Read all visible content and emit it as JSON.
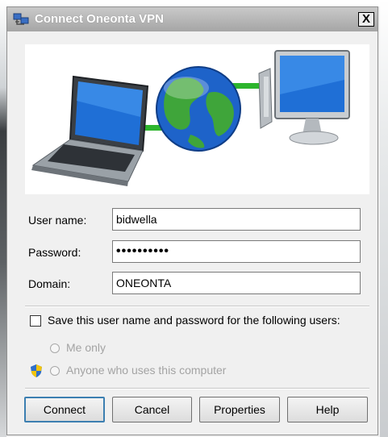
{
  "window": {
    "title": "Connect Oneonta VPN",
    "close_label": "X"
  },
  "fields": {
    "username": {
      "label": "User name:",
      "value": "bidwella"
    },
    "password": {
      "label": "Password:",
      "value": "••••••••••"
    },
    "domain": {
      "label": "Domain:",
      "value": "ONEONTA"
    }
  },
  "save": {
    "label": "Save this user name and password for the following users:",
    "checked": false,
    "options": [
      {
        "label": "Me only",
        "enabled": false
      },
      {
        "label": "Anyone who uses this computer",
        "enabled": false
      }
    ]
  },
  "buttons": {
    "connect": "Connect",
    "cancel": "Cancel",
    "properties": "Properties",
    "help": "Help"
  },
  "icons": {
    "title": "vpn-connection-icon",
    "banner": [
      "laptop-icon",
      "globe-icon",
      "desktop-computer-icon"
    ],
    "admin": "uac-shield-icon"
  },
  "colors": {
    "connection_line": "#2db52d",
    "default_button_border": "#3c7fb1"
  }
}
